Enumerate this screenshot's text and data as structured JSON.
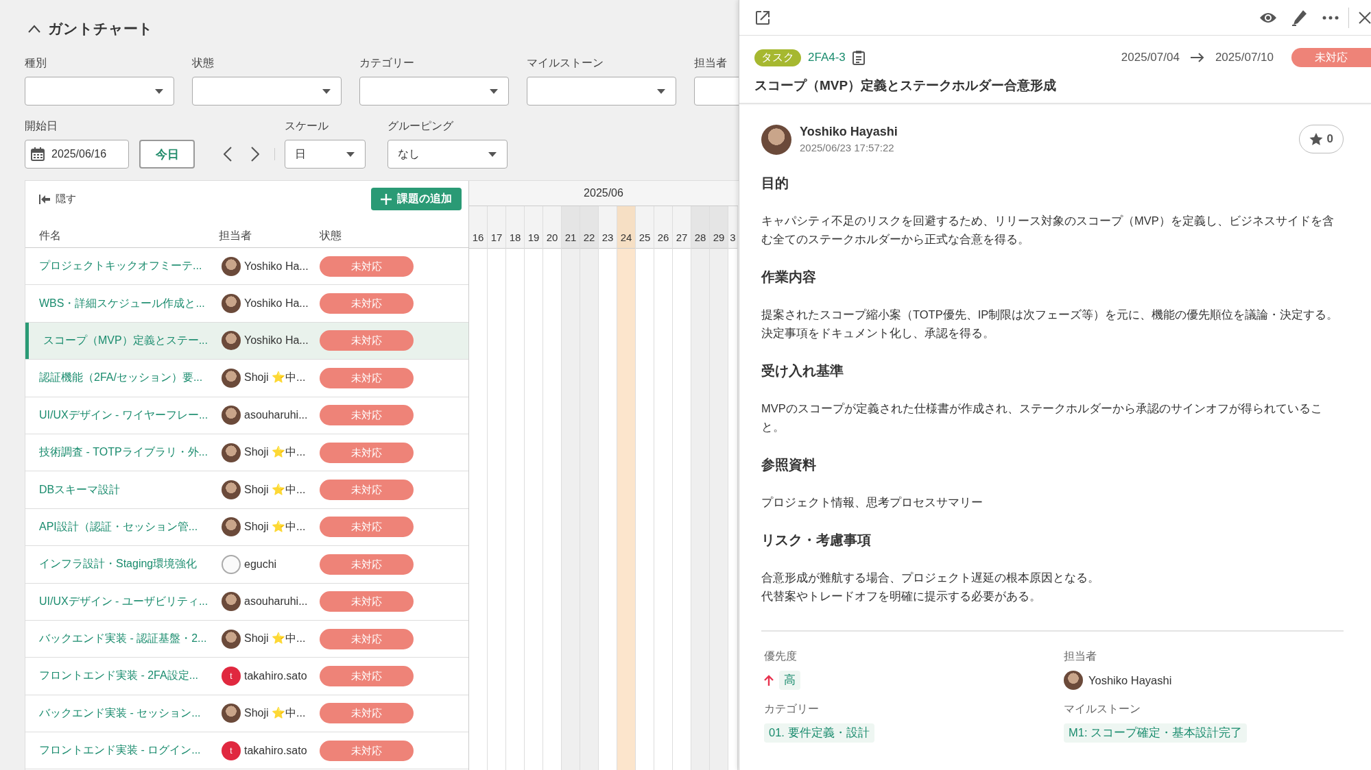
{
  "header": {
    "title": "ガントチャート",
    "expanded": true
  },
  "filters": [
    {
      "label": "種別"
    },
    {
      "label": "状態"
    },
    {
      "label": "カテゴリー"
    },
    {
      "label": "マイルストーン"
    },
    {
      "label": "担当者"
    }
  ],
  "start_date": {
    "label": "開始日",
    "value": "2025/06/16"
  },
  "today_button": "今日",
  "scale": {
    "label": "スケール",
    "value": "日"
  },
  "grouping": {
    "label": "グルーピング",
    "value": "なし"
  },
  "list": {
    "hide_label": "隠す",
    "add_button": "課題の追加",
    "columns": [
      "件名",
      "担当者",
      "状態"
    ],
    "rows": [
      {
        "title": "プロジェクトキックオフミーテ...",
        "assignee": "Yoshiko Ha...",
        "avatar": {
          "kind": "photo"
        },
        "status": "未対応",
        "selected": false
      },
      {
        "title": "WBS・詳細スケジュール作成と...",
        "assignee": "Yoshiko Ha...",
        "avatar": {
          "kind": "photo"
        },
        "status": "未対応",
        "selected": false
      },
      {
        "title": "スコープ（MVP）定義とステー...",
        "assignee": "Yoshiko Ha...",
        "avatar": {
          "kind": "photo"
        },
        "status": "未対応",
        "selected": true
      },
      {
        "title": "認証機能（2FA/セッション）要...",
        "assignee": "Shoji ⭐中...",
        "avatar": {
          "kind": "photo"
        },
        "status": "未対応",
        "selected": false
      },
      {
        "title": "UI/UXデザイン - ワイヤーフレー...",
        "assignee": "asouharuhi...",
        "avatar": {
          "kind": "photo"
        },
        "status": "未対応",
        "selected": false
      },
      {
        "title": "技術調査 - TOTPライブラリ・外...",
        "assignee": "Shoji ⭐中...",
        "avatar": {
          "kind": "photo"
        },
        "status": "未対応",
        "selected": false
      },
      {
        "title": "DBスキーマ設計",
        "assignee": "Shoji ⭐中...",
        "avatar": {
          "kind": "photo"
        },
        "status": "未対応",
        "selected": false
      },
      {
        "title": "API設計（認証・セッション管...",
        "assignee": "Shoji ⭐中...",
        "avatar": {
          "kind": "photo"
        },
        "status": "未対応",
        "selected": false
      },
      {
        "title": "インフラ設計・Staging環境強化",
        "assignee": "eguchi",
        "avatar": {
          "kind": "sketch"
        },
        "status": "未対応",
        "selected": false
      },
      {
        "title": "UI/UXデザイン - ユーザビリティ...",
        "assignee": "asouharuhi...",
        "avatar": {
          "kind": "photo"
        },
        "status": "未対応",
        "selected": false
      },
      {
        "title": "バックエンド実装 - 認証基盤・2...",
        "assignee": "Shoji ⭐中...",
        "avatar": {
          "kind": "photo"
        },
        "status": "未対応",
        "selected": false
      },
      {
        "title": "フロントエンド実装 - 2FA設定...",
        "assignee": "takahiro.sato",
        "avatar": {
          "kind": "letter",
          "letter": "t"
        },
        "status": "未対応",
        "selected": false
      },
      {
        "title": "バックエンド実装 - セッション...",
        "assignee": "Shoji ⭐中...",
        "avatar": {
          "kind": "photo"
        },
        "status": "未対応",
        "selected": false
      },
      {
        "title": "フロントエンド実装 - ログイン...",
        "assignee": "takahiro.sato",
        "avatar": {
          "kind": "letter",
          "letter": "t"
        },
        "status": "未対応",
        "selected": false
      }
    ]
  },
  "timeline": {
    "month": "2025/06",
    "days": [
      {
        "label": "16",
        "kind": "weekday"
      },
      {
        "label": "17",
        "kind": "weekday"
      },
      {
        "label": "18",
        "kind": "weekday"
      },
      {
        "label": "19",
        "kind": "weekday"
      },
      {
        "label": "20",
        "kind": "weekday"
      },
      {
        "label": "21",
        "kind": "weekend"
      },
      {
        "label": "22",
        "kind": "weekend"
      },
      {
        "label": "23",
        "kind": "weekday"
      },
      {
        "label": "24",
        "kind": "today"
      },
      {
        "label": "25",
        "kind": "weekday"
      },
      {
        "label": "26",
        "kind": "weekday"
      },
      {
        "label": "27",
        "kind": "weekday"
      },
      {
        "label": "28",
        "kind": "weekend"
      },
      {
        "label": "29",
        "kind": "weekend"
      },
      {
        "label": "3",
        "kind": "weekday"
      }
    ]
  },
  "detail": {
    "type_badge": "タスク",
    "key": "2FA4-3",
    "start": "2025/07/04",
    "end": "2025/07/10",
    "status": "未対応",
    "title": "スコープ（MVP）定義とステークホルダー合意形成",
    "author": "Yoshiko Hayashi",
    "timestamp": "2025/06/23 17:57:22",
    "star_count": "0",
    "sections": [
      {
        "heading": "目的",
        "lines": [
          "キャパシティ不足のリスクを回避するため、リリース対象のスコープ（MVP）を定義し、ビジネスサイドを含む全てのステークホルダーから正式な合意を得る。"
        ]
      },
      {
        "heading": "作業内容",
        "lines": [
          "提案されたスコープ縮小案（TOTP優先、IP制限は次フェーズ等）を元に、機能の優先順位を議論・決定する。決定事項をドキュメント化し、承認を得る。"
        ]
      },
      {
        "heading": "受け入れ基準",
        "lines": [
          "MVPのスコープが定義された仕様書が作成され、ステークホルダーから承認のサインオフが得られていること。"
        ]
      },
      {
        "heading": "参照資料",
        "lines": [
          "プロジェクト情報、思考プロセスサマリー"
        ]
      },
      {
        "heading": "リスク・考慮事項",
        "lines": [
          "合意形成が難航する場合、プロジェクト遅延の根本原因となる。",
          "代替案やトレードオフを明確に提示する必要がある。"
        ]
      }
    ],
    "properties": [
      {
        "label": "優先度",
        "kind": "priority",
        "value": "高"
      },
      {
        "label": "担当者",
        "kind": "user",
        "value": "Yoshiko Hayashi"
      },
      {
        "label": "カテゴリー",
        "kind": "tag",
        "value": "01. 要件定義・設計"
      },
      {
        "label": "マイルストーン",
        "kind": "tag",
        "value": "M1: スコープ確定・基本設計完了"
      }
    ]
  }
}
